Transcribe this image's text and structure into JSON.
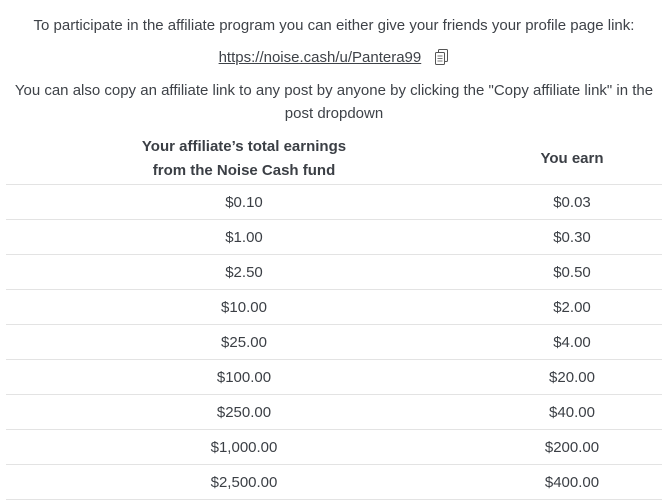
{
  "intro": {
    "line1": "To participate in the affiliate program you can either give your friends your profile page link:",
    "profile_link": "https://noise.cash/u/Pantera99",
    "copy_icon": "copy-icon",
    "line2": "You can also copy an affiliate link to any post by anyone by clicking the \"Copy affiliate link\" in the post dropdown"
  },
  "table": {
    "headers": {
      "earnings_line1": "Your affiliate’s total earnings",
      "earnings_line2": "from the Noise Cash fund",
      "you_earn": "You earn"
    },
    "rows": [
      {
        "earnings": "$0.10",
        "you_earn": "$0.03"
      },
      {
        "earnings": "$1.00",
        "you_earn": "$0.30"
      },
      {
        "earnings": "$2.50",
        "you_earn": "$0.50"
      },
      {
        "earnings": "$10.00",
        "you_earn": "$2.00"
      },
      {
        "earnings": "$25.00",
        "you_earn": "$4.00"
      },
      {
        "earnings": "$100.00",
        "you_earn": "$20.00"
      },
      {
        "earnings": "$250.00",
        "you_earn": "$40.00"
      },
      {
        "earnings": "$1,000.00",
        "you_earn": "$200.00"
      },
      {
        "earnings": "$2,500.00",
        "you_earn": "$400.00"
      }
    ]
  }
}
